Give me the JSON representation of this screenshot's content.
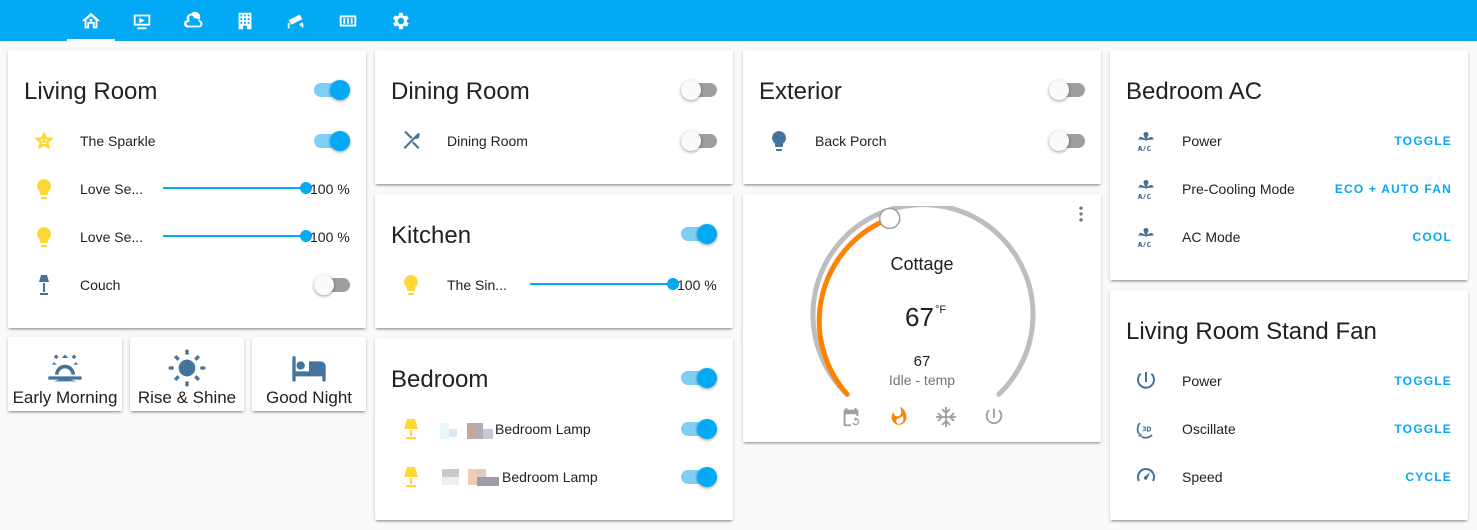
{
  "nav": {
    "tabs": [
      {
        "icon": "home-icon",
        "active": true
      },
      {
        "icon": "media-icon",
        "active": false
      },
      {
        "icon": "weather-icon",
        "active": false
      },
      {
        "icon": "building-icon",
        "active": false
      },
      {
        "icon": "security-camera-icon",
        "active": false
      },
      {
        "icon": "memory-icon",
        "active": false
      },
      {
        "icon": "settings-icon",
        "active": false
      }
    ]
  },
  "colors": {
    "accent": "#03a9f4",
    "icon_blue": "#44739e",
    "bulb_yellow": "#fdd835",
    "heat_orange": "#ff8100"
  },
  "living_room": {
    "title": "Living Room",
    "master_on": true,
    "entities": [
      {
        "name": "The Sparkle",
        "icon": "star-face-icon",
        "type": "toggle",
        "on": true
      },
      {
        "name": "Love Se...",
        "icon": "lightbulb-icon",
        "type": "slider",
        "value": "100 %",
        "level": 1.0
      },
      {
        "name": "Love Se...",
        "icon": "lightbulb-icon",
        "type": "slider",
        "value": "100 %",
        "level": 1.0
      },
      {
        "name": "Couch",
        "icon": "floor-lamp-icon",
        "type": "toggle",
        "on": false
      }
    ]
  },
  "scenes": [
    {
      "label": "Early Morning",
      "icon": "sunrise-icon"
    },
    {
      "label": "Rise & Shine",
      "icon": "sun-icon"
    },
    {
      "label": "Good Night",
      "icon": "bed-icon"
    }
  ],
  "dining_room": {
    "title": "Dining Room",
    "master_on": false,
    "entities": [
      {
        "name": "Dining Room",
        "icon": "silverware-icon",
        "on": false
      }
    ]
  },
  "kitchen": {
    "title": "Kitchen",
    "master_on": true,
    "entities": [
      {
        "name": "The Sin...",
        "icon": "lightbulb-icon",
        "value": "100 %",
        "level": 1.0
      }
    ]
  },
  "bedroom": {
    "title": "Bedroom",
    "master_on": true,
    "entities": [
      {
        "name": "Bedroom Lamp",
        "icon": "lamp-icon",
        "on": true
      },
      {
        "name": "Bedroom Lamp",
        "icon": "lamp-icon",
        "on": true
      }
    ]
  },
  "exterior": {
    "title": "Exterior",
    "master_on": false,
    "entities": [
      {
        "name": "Back Porch",
        "icon": "lightbulb-icon",
        "on": false
      }
    ]
  },
  "thermostat": {
    "name": "Cottage",
    "target": "67",
    "unit": "°F",
    "current": "67",
    "status": "Idle - temp",
    "modes": [
      "calendar-sync-icon",
      "fire-icon",
      "snowflake-icon",
      "power-icon"
    ],
    "active_mode": "fire-icon"
  },
  "bedroom_ac": {
    "title": "Bedroom AC",
    "entities": [
      {
        "name": "Power",
        "icon": "air-conditioner-icon",
        "action": "TOGGLE"
      },
      {
        "name": "Pre-Cooling Mode",
        "icon": "air-conditioner-icon",
        "action": "ECO + AUTO FAN"
      },
      {
        "name": "AC Mode",
        "icon": "air-conditioner-icon",
        "action": "COOL"
      }
    ]
  },
  "stand_fan": {
    "title": "Living Room Stand Fan",
    "entities": [
      {
        "name": "Power",
        "icon": "power-icon",
        "action": "TOGGLE"
      },
      {
        "name": "Oscillate",
        "icon": "rotate-3d-icon",
        "action": "TOGGLE"
      },
      {
        "name": "Speed",
        "icon": "speedometer-icon",
        "action": "CYCLE"
      }
    ]
  }
}
